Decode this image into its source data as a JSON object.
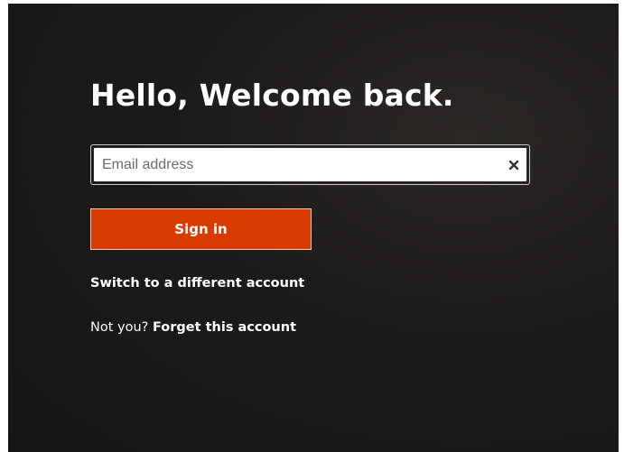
{
  "header": {
    "title": "Hello, Welcome back."
  },
  "email": {
    "placeholder": "Email address",
    "value": "",
    "clear_icon": "close-icon"
  },
  "actions": {
    "signin_label": "Sign in",
    "switch_account_label": "Switch to a different account",
    "not_you_text": "Not you?",
    "forget_account_label": "Forget this account"
  },
  "colors": {
    "accent": "#d83b01",
    "background": "#1d1b1a",
    "text": "#ffffff"
  }
}
